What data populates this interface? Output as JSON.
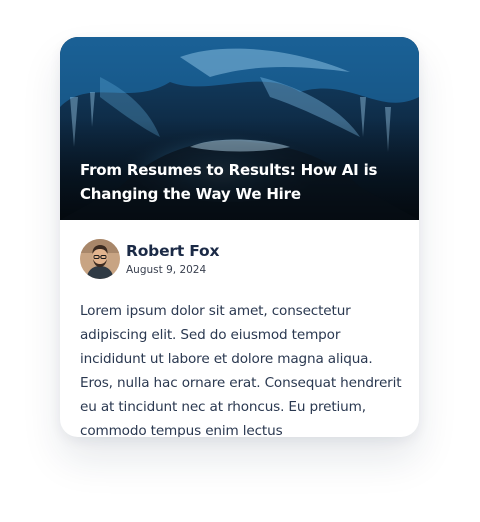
{
  "post": {
    "title": "From Resumes to Results: How AI is Changing the Way We Hire",
    "author_name": "Robert Fox",
    "date": "August 9, 2024",
    "body": "Lorem ipsum dolor sit amet, consectetur adipiscing elit. Sed do eiusmod tempor incididunt ut labore et dolore magna aliqua. Eros, nulla hac ornare erat. Consequat hendrerit eu at tincidunt nec at rhoncus. Eu pretium, commodo tempus enim lectus"
  },
  "colors": {
    "title_text": "#ffffff",
    "author_name": "#1b2a46",
    "body_text": "#2a3850",
    "card_background": "#ffffff",
    "hero_dark": "#0a1420",
    "hero_accent": "#1f79b8"
  },
  "icons": {
    "hero": "ice-cave-photo",
    "avatar": "author-photo"
  }
}
